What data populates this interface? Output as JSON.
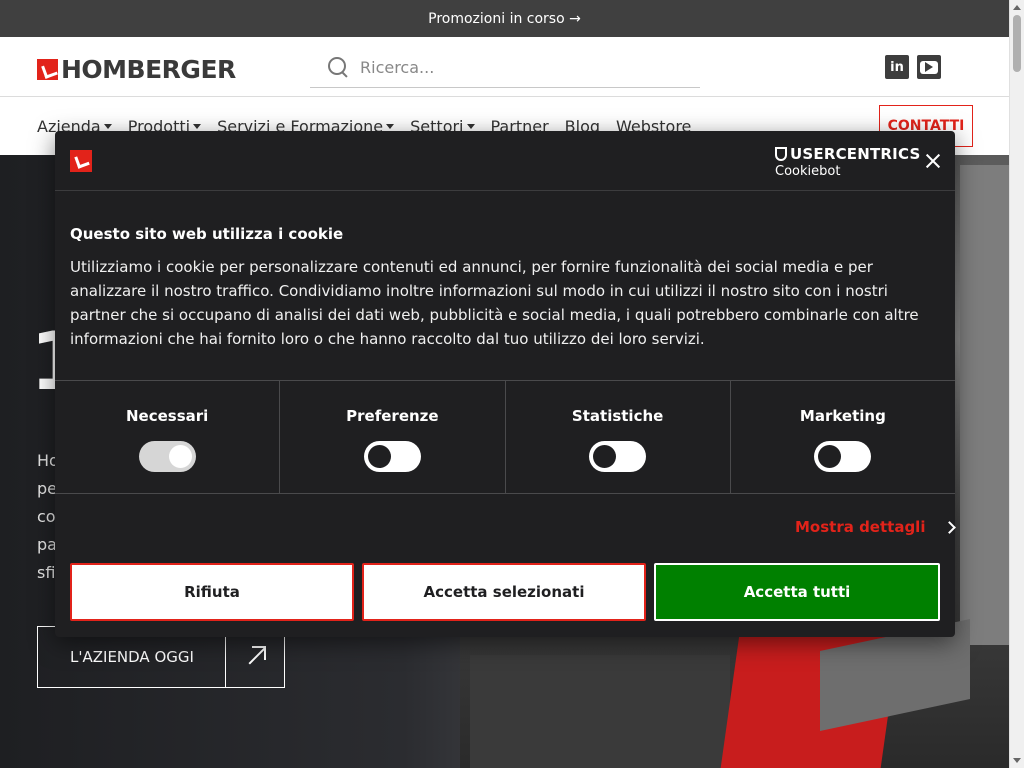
{
  "promo": {
    "text": "Promozioni in corso →"
  },
  "header": {
    "logo_text": "HOMBERGER",
    "search": {
      "placeholder": "Ricerca..."
    },
    "social": [
      {
        "label": "in"
      },
      {
        "label": "YouTube"
      }
    ]
  },
  "nav": {
    "items": [
      {
        "label": "Azienda",
        "dropdown": true
      },
      {
        "label": "Prodotti",
        "dropdown": true
      },
      {
        "label": "Servizi e Formazione",
        "dropdown": true
      },
      {
        "label": "Settori",
        "dropdown": true
      },
      {
        "label": "Partner",
        "dropdown": false
      },
      {
        "label": "Blog",
        "dropdown": false
      },
      {
        "label": "Webstore",
        "dropdown": false
      }
    ],
    "contact_label": "CONTATTI"
  },
  "hero": {
    "big_char": "1",
    "partial_lines": [
      "Ho",
      "pe",
      "co",
      "pa",
      "sfi"
    ],
    "button_label": "L'AZIENDA OGGI"
  },
  "cookie": {
    "brand": "USERCENTRICS",
    "brand_sub": "Cookiebot",
    "title": "Questo sito web utilizza i cookie",
    "body": "Utilizziamo i cookie per personalizzare contenuti ed annunci, per fornire funzionalità dei social media e per analizzare il nostro traffico. Condividiamo inoltre informazioni sul modo in cui utilizzi il nostro sito con i nostri partner che si occupano di analisi dei dati web, pubblicità e social media, i quali potrebbero combinarle con altre informazioni che hai fornito loro o che hanno raccolto dal tuo utilizzo dei loro servizi.",
    "switches": [
      {
        "label": "Necessari",
        "checked": true
      },
      {
        "label": "Preferenze",
        "checked": false
      },
      {
        "label": "Statistiche",
        "checked": false
      },
      {
        "label": "Marketing",
        "checked": false
      }
    ],
    "details_label": "Mostra dettagli",
    "buttons": {
      "deny": "Rifiuta",
      "selected": "Accetta selezionati",
      "all": "Accetta tutti"
    }
  },
  "colors": {
    "brand_red": "#e2231a",
    "dialog_bg": "#1f1f21",
    "accept_green": "#008000",
    "promo_bg": "#404040"
  }
}
